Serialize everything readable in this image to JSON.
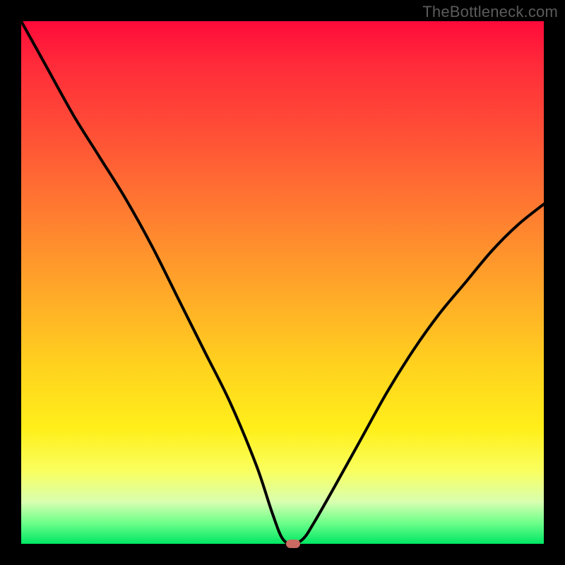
{
  "attribution": "TheBottleneck.com",
  "chart_data": {
    "type": "line",
    "title": "",
    "xlabel": "",
    "ylabel": "",
    "xlim": [
      0,
      100
    ],
    "ylim": [
      0,
      100
    ],
    "x": [
      0,
      5,
      10,
      15,
      20,
      25,
      30,
      35,
      40,
      45,
      48,
      50,
      52,
      54,
      56,
      60,
      65,
      70,
      75,
      80,
      85,
      90,
      95,
      100
    ],
    "values": [
      100,
      91,
      82,
      74,
      66,
      57,
      47,
      37,
      27,
      15,
      6,
      1,
      0,
      1,
      4,
      11,
      20,
      29,
      37,
      44,
      50,
      56,
      61,
      65
    ],
    "marker": {
      "x": 52,
      "y": 0
    },
    "colors": {
      "gradient_top": "#ff0a3a",
      "gradient_mid": "#ffd21e",
      "gradient_bottom": "#00e763",
      "curve": "#000000",
      "marker": "#cb6a62"
    }
  }
}
